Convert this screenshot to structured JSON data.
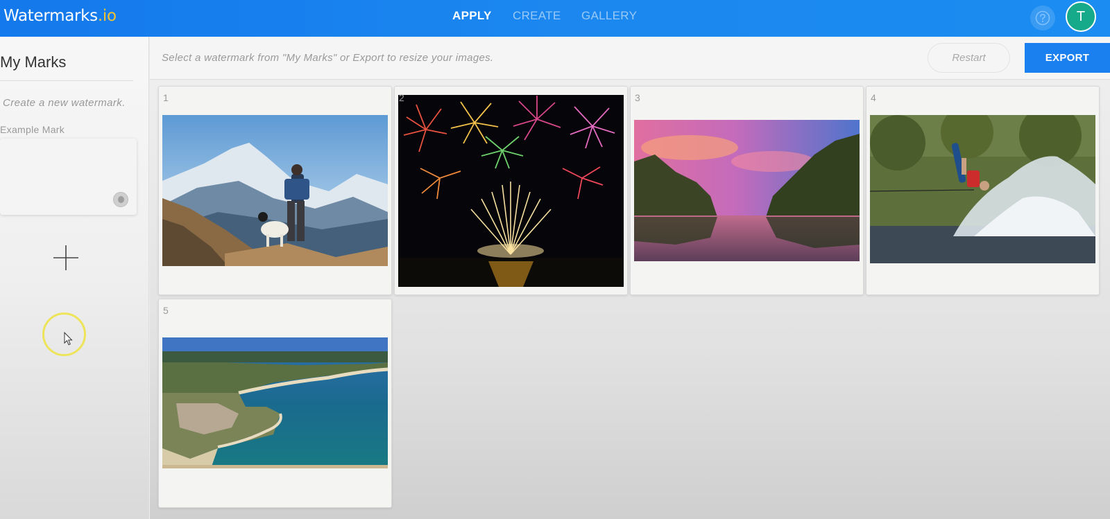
{
  "brand": {
    "name": "Watermarks",
    "tld": ".io"
  },
  "nav": {
    "tabs": [
      {
        "label": "APPLY",
        "active": true
      },
      {
        "label": "CREATE",
        "active": false
      },
      {
        "label": "GALLERY",
        "active": false
      }
    ],
    "help_icon": "question-circle-icon",
    "avatar_initial": "T"
  },
  "sidebar": {
    "title": "My Marks",
    "create_link": "Create a new watermark.",
    "marks": [
      {
        "label": "Example Mark"
      }
    ],
    "add_icon": "plus-icon"
  },
  "toolbar": {
    "hint": "Select a watermark from \"My Marks\" or Export to resize your images.",
    "restart_label": "Restart",
    "export_label": "EXPORT"
  },
  "images": [
    {
      "number": "1",
      "subject": "hiker-with-dog-mountains"
    },
    {
      "number": "2",
      "subject": "fireworks-over-water"
    },
    {
      "number": "3",
      "subject": "river-sunset-trees"
    },
    {
      "number": "4",
      "subject": "wakeboarder-splash"
    },
    {
      "number": "5",
      "subject": "aerial-coastline"
    }
  ],
  "colors": {
    "topbar": "#1b87ef",
    "accent": "#1a7fef",
    "tld": "#f1c232",
    "avatar": "#16a98a"
  }
}
